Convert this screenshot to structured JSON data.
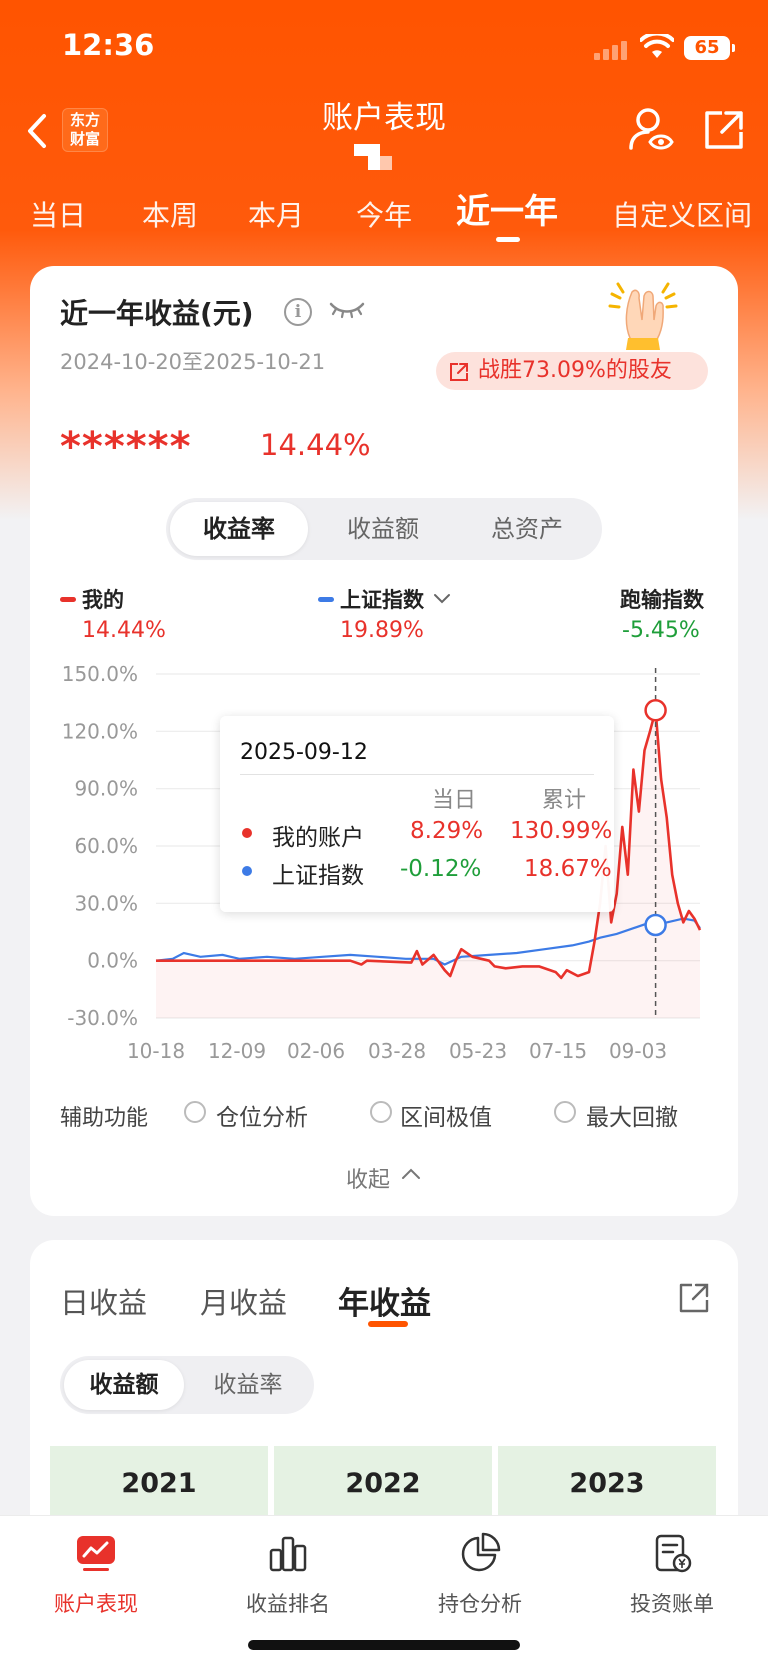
{
  "status_bar": {
    "time": "12:36",
    "battery": "65"
  },
  "header": {
    "title": "账户表现",
    "logo_text_line1": "东方",
    "logo_text_line2": "财富"
  },
  "period_tabs": [
    "当日",
    "本周",
    "本月",
    "今年",
    "近一年",
    "自定义区间"
  ],
  "period_active_index": 4,
  "summary": {
    "title": "近一年收益(元)",
    "date_range": "2024-10-20至2025-10-21",
    "beat_text": "战胜73.09%的股友",
    "masked_amount": "******",
    "total_rate": "14.44%"
  },
  "metric_tabs": [
    "收益率",
    "收益额",
    "总资产"
  ],
  "metric_active_index": 0,
  "legend": {
    "mine": {
      "name": "我的",
      "value": "14.44%",
      "color": "#e8322b"
    },
    "index": {
      "name": "上证指数",
      "value": "19.89%",
      "color": "#3d7be6"
    },
    "diff": {
      "name": "跑输指数",
      "value": "-5.45%",
      "color": "#1f9e3a"
    }
  },
  "tooltip": {
    "date": "2025-09-12",
    "col_daily": "当日",
    "col_cum": "累计",
    "rows": [
      {
        "name": "我的账户",
        "daily": "8.29%",
        "cum": "130.99%"
      },
      {
        "name": "上证指数",
        "daily": "-0.12%",
        "cum": "18.67%"
      }
    ]
  },
  "chart_data": {
    "type": "line",
    "ylim": [
      -30,
      150
    ],
    "y_ticks": [
      "150.0%",
      "120.0%",
      "90.0%",
      "60.0%",
      "30.0%",
      "0.0%",
      "-30.0%"
    ],
    "x_ticks": [
      "10-18",
      "12-09",
      "02-06",
      "03-28",
      "05-23",
      "07-15",
      "09-03"
    ],
    "grid": true,
    "series": [
      {
        "name": "我的",
        "color": "#e8322b",
        "points": [
          [
            0,
            0
          ],
          [
            2,
            0
          ],
          [
            4,
            0
          ],
          [
            5,
            0
          ],
          [
            10,
            0
          ],
          [
            20,
            0
          ],
          [
            35,
            0
          ],
          [
            37,
            -2
          ],
          [
            38,
            0
          ],
          [
            46,
            -1
          ],
          [
            47,
            5
          ],
          [
            48,
            -2
          ],
          [
            50,
            3
          ],
          [
            52,
            -5
          ],
          [
            53,
            -8
          ],
          [
            54,
            0
          ],
          [
            55,
            6
          ],
          [
            57,
            2
          ],
          [
            60,
            0
          ],
          [
            61,
            -3
          ],
          [
            63,
            -4
          ],
          [
            66,
            -3
          ],
          [
            69,
            -3
          ],
          [
            72,
            -6
          ],
          [
            73,
            -9
          ],
          [
            74,
            -5
          ],
          [
            76,
            -8
          ],
          [
            78,
            -6
          ],
          [
            79,
            10
          ],
          [
            80,
            30
          ],
          [
            81,
            60
          ],
          [
            82,
            20
          ],
          [
            83,
            35
          ],
          [
            84,
            70
          ],
          [
            85,
            45
          ],
          [
            86,
            100
          ],
          [
            87,
            78
          ],
          [
            88,
            110
          ],
          [
            89,
            120
          ],
          [
            90,
            131
          ],
          [
            91,
            95
          ],
          [
            92,
            75
          ],
          [
            93,
            45
          ],
          [
            94,
            30
          ],
          [
            95,
            20
          ],
          [
            96,
            26
          ],
          [
            97,
            22
          ],
          [
            98,
            16
          ]
        ]
      },
      {
        "name": "上证指数",
        "color": "#3d7be6",
        "points": [
          [
            0,
            0
          ],
          [
            3,
            1
          ],
          [
            5,
            4
          ],
          [
            8,
            2
          ],
          [
            12,
            3
          ],
          [
            15,
            1
          ],
          [
            20,
            2
          ],
          [
            25,
            1
          ],
          [
            30,
            2
          ],
          [
            35,
            3
          ],
          [
            40,
            2
          ],
          [
            45,
            1
          ],
          [
            50,
            1
          ],
          [
            52,
            -2
          ],
          [
            55,
            2
          ],
          [
            60,
            3
          ],
          [
            65,
            4
          ],
          [
            70,
            6
          ],
          [
            75,
            8
          ],
          [
            78,
            10
          ],
          [
            80,
            12
          ],
          [
            83,
            14
          ],
          [
            86,
            17
          ],
          [
            88,
            19
          ],
          [
            90,
            18.67
          ],
          [
            92,
            20
          ],
          [
            95,
            22
          ],
          [
            97,
            21
          ],
          [
            98,
            17
          ]
        ]
      }
    ],
    "highlight_index_x": 90
  },
  "aux": {
    "label": "辅助功能",
    "options": [
      "仓位分析",
      "区间极值",
      "最大回撤"
    ],
    "collapse": "收起"
  },
  "yield_tabs": [
    "日收益",
    "月收益",
    "年收益"
  ],
  "yield_active_index": 2,
  "yield_seg": [
    "收益额",
    "收益率"
  ],
  "years": [
    "2021",
    "2022",
    "2023"
  ],
  "bottom_nav": [
    "账户表现",
    "收益排名",
    "持仓分析",
    "投资账单"
  ]
}
